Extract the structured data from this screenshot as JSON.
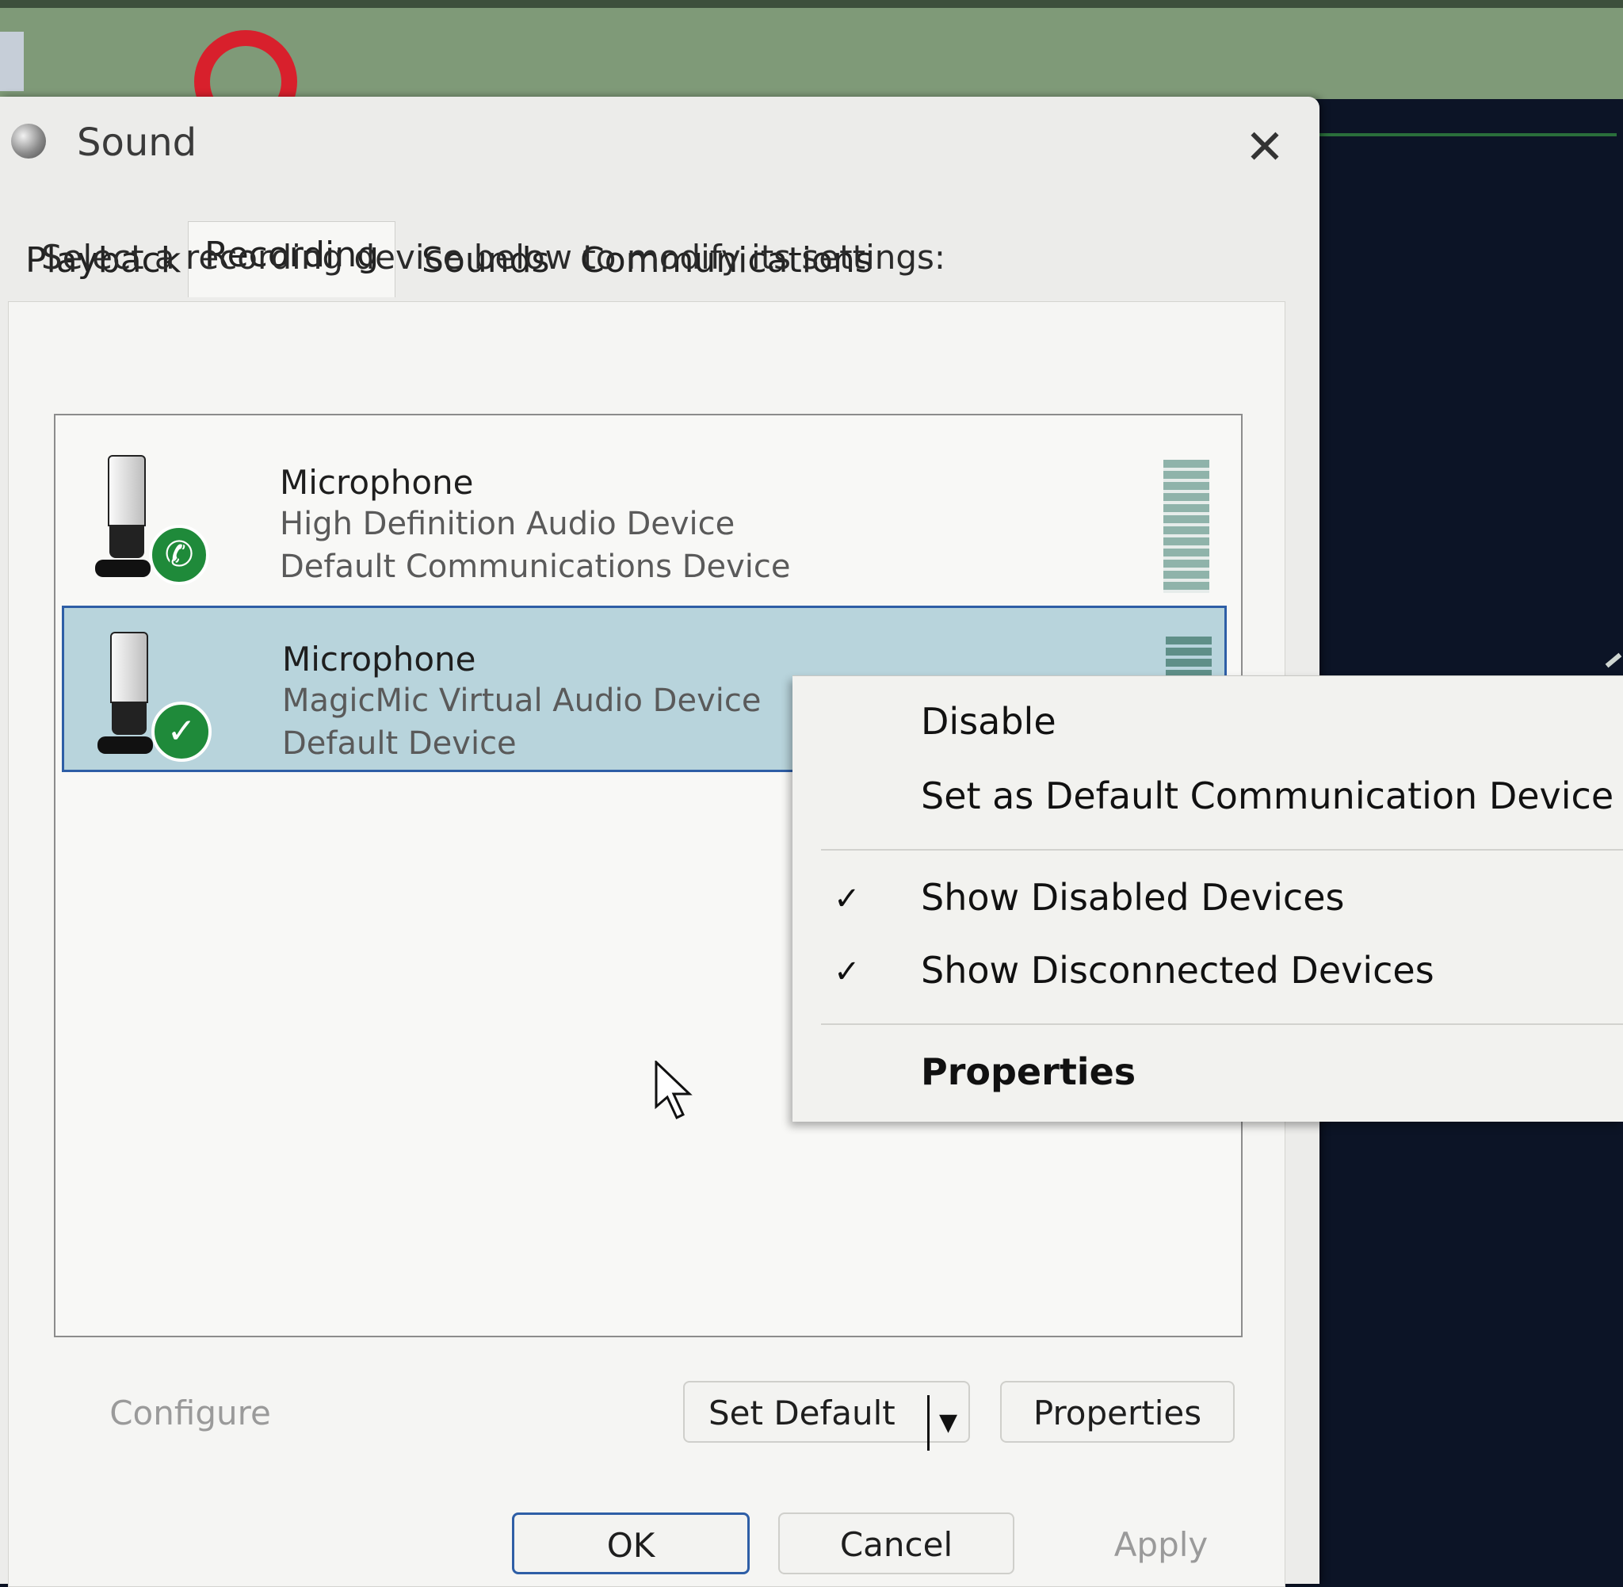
{
  "window": {
    "title": "Sound",
    "close_glyph": "✕"
  },
  "tabs": [
    {
      "label": "Playback"
    },
    {
      "label": "Recording"
    },
    {
      "label": "Sounds"
    },
    {
      "label": "Communications"
    }
  ],
  "instruction": "Select a recording device below to modify its settings:",
  "devices": [
    {
      "name": "Microphone",
      "driver": "High Definition Audio Device",
      "status": "Default Communications Device",
      "badge_icon": "phone-icon",
      "badge_glyph": "✆"
    },
    {
      "name": "Microphone",
      "driver": "MagicMic Virtual Audio Device",
      "status": "Default Device",
      "badge_icon": "checkmark-icon",
      "badge_glyph": "✓"
    }
  ],
  "context_menu": {
    "items": [
      {
        "label": "Disable"
      },
      {
        "label": "Set as Default Communication Device"
      },
      {
        "label": "Show Disabled Devices",
        "checked": true
      },
      {
        "label": "Show Disconnected Devices",
        "checked": true
      },
      {
        "label": "Properties"
      }
    ],
    "check_glyph": "✓"
  },
  "buttons": {
    "configure": "Configure",
    "set_default": "Set Default",
    "set_default_arrow": "▼",
    "properties": "Properties",
    "ok": "OK",
    "cancel": "Cancel",
    "apply": "Apply"
  },
  "colors": {
    "selection": "#b8d4dc",
    "selection_border": "#2e5ea6",
    "badge_green": "#1f8a3a"
  }
}
